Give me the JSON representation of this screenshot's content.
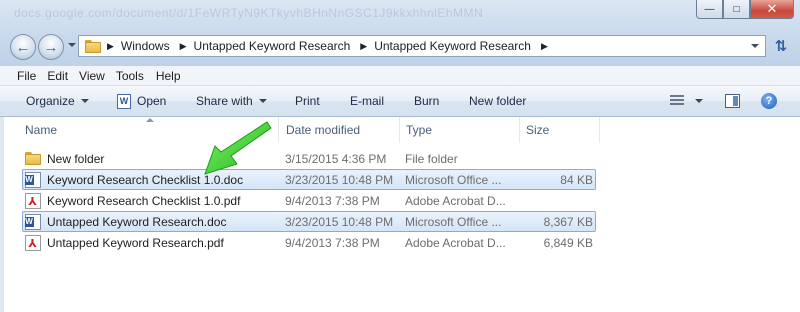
{
  "window": {
    "blurred_title": "docs.google.com/document/d/1FeWRTyN9KTkyvhBHnNnGSC1J9kkxhhnlEhMMN",
    "buttons": {
      "minimize": "—",
      "maximize": "□",
      "close": "✕"
    }
  },
  "address": {
    "crumbs": [
      "Windows",
      "Untapped Keyword Research",
      "Untapped Keyword Research"
    ]
  },
  "menu": [
    {
      "label": "File"
    },
    {
      "label": "Edit"
    },
    {
      "label": "View"
    },
    {
      "label": "Tools"
    },
    {
      "label": "Help"
    }
  ],
  "toolbar": {
    "organize": "Organize",
    "open": "Open",
    "share_with": "Share with",
    "print": "Print",
    "email": "E-mail",
    "burn": "Burn",
    "new_folder": "New folder"
  },
  "columns": {
    "name": "Name",
    "date": "Date modified",
    "type": "Type",
    "size": "Size"
  },
  "files": [
    {
      "icon": "folder-icon",
      "name": "New folder",
      "date": "3/15/2015 4:36 PM",
      "type": "File folder",
      "size": "",
      "selected": false
    },
    {
      "icon": "word-doc-icon",
      "name": "Keyword Research Checklist 1.0.doc",
      "date": "3/23/2015 10:48 PM",
      "type": "Microsoft Office ...",
      "size": "84 KB",
      "selected": true
    },
    {
      "icon": "pdf-icon",
      "name": "Keyword Research Checklist 1.0.pdf",
      "date": "9/4/2013 7:38 PM",
      "type": "Adobe Acrobat D...",
      "size": "",
      "selected": false
    },
    {
      "icon": "word-doc-icon",
      "name": "Untapped Keyword Research.doc",
      "date": "3/23/2015 10:48 PM",
      "type": "Microsoft Office ...",
      "size": "8,367 KB",
      "selected": true
    },
    {
      "icon": "pdf-icon",
      "name": "Untapped Keyword Research.pdf",
      "date": "9/4/2013 7:38 PM",
      "type": "Adobe Acrobat D...",
      "size": "6,849 KB",
      "selected": false
    }
  ],
  "colors": {
    "selection_fill": "#d4e5f8",
    "selection_border": "#84acdd",
    "annotation_arrow": "#3ad12e"
  }
}
